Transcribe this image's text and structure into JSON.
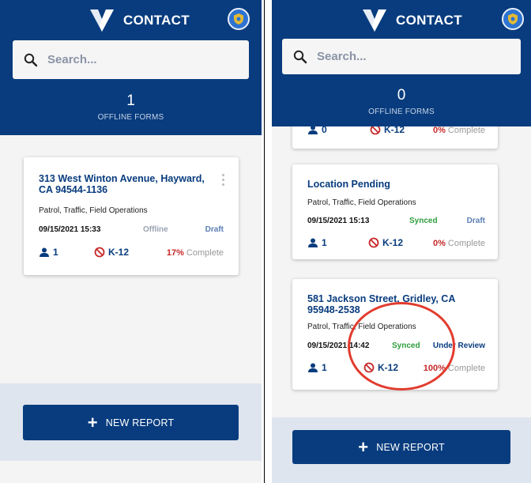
{
  "app": {
    "title": "CONTACT",
    "search_placeholder": "Search...",
    "offline_label": "OFFLINE FORMS",
    "new_report_label": "NEW REPORT",
    "complete_label": "Complete"
  },
  "left": {
    "offline_count": "1",
    "cards": [
      {
        "address": "313 West Winton Avenue, Hayward, CA 94544-1136",
        "categories": "Patrol, Traffic, Field Operations",
        "datetime": "09/15/2021 15:33",
        "sync": "Offline",
        "status": "Draft",
        "people": "1",
        "school": "K-12",
        "percent": "17%"
      }
    ]
  },
  "right": {
    "offline_count": "0",
    "partial_card": {
      "people": "0",
      "school": "K-12",
      "percent": "0%"
    },
    "cards": [
      {
        "address": "Location Pending",
        "categories": "Patrol, Traffic, Field Operations",
        "datetime": "09/15/2021 15:13",
        "sync": "Synced",
        "status": "Draft",
        "people": "1",
        "school": "K-12",
        "percent": "0%"
      },
      {
        "address": "581 Jackson Street, Gridley, CA 95948-2538",
        "categories": "Patrol, Traffic, Field Operations",
        "datetime": "09/15/2021 14:42",
        "sync": "Synced",
        "status": "Under Review",
        "people": "1",
        "school": "K-12",
        "percent": "100%"
      }
    ]
  },
  "colors": {
    "brand": "#083c7e",
    "offline": "#9aa3b1",
    "draft": "#5b7fb5",
    "synced": "#2e9e3e",
    "under_review": "#083c7e",
    "percent": "#c62828",
    "annotation": "#e23b2e"
  }
}
